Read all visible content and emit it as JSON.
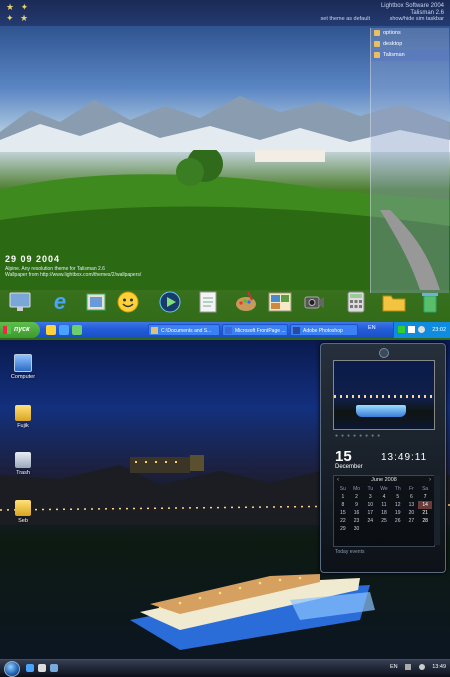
{
  "top_screen": {
    "brand_lines": [
      "Lightbox Software 2004",
      "Talisman 2.6"
    ],
    "brand_links": [
      "set theme as default",
      "show/hide sim taskbar"
    ],
    "side_panel": {
      "items": [
        {
          "label": "options",
          "active": false
        },
        {
          "label": "desktop",
          "active": false
        },
        {
          "label": "Talisman",
          "active": true
        }
      ]
    },
    "date": "29  09  2004",
    "caption_lines": [
      "Alpine. Any resolution theme for Talisman 2.6",
      "Wallpaper from http://www.lightbox.com/themes/2/wallpapers/"
    ],
    "dock_icons": [
      "monitor-icon",
      "internet-explorer-icon",
      "mail-stamp-icon",
      "smiley-messenger-icon",
      "media-player-icon",
      "notepad-icon",
      "paint-palette-icon",
      "photo-album-icon",
      "video-camera-icon",
      "calculator-icon",
      "folder-icon",
      "recycle-bin-icon"
    ],
    "taskbar": {
      "start_label": "пуск",
      "tasks": [
        "C:\\Documents and S...",
        "Microsoft FrontPage ...",
        "Adobe Photoshop"
      ],
      "language": "EN",
      "clock": "23:02"
    }
  },
  "bottom_screen": {
    "desktop_icons": [
      "Computer",
      "Fujik",
      "Trash",
      "Seb"
    ],
    "gadget": {
      "day": "15",
      "month": "December",
      "time": "13:49:11",
      "calendar_title": "June 2008",
      "weekdays": [
        "Su",
        "Mo",
        "Tu",
        "We",
        "Th",
        "Fr",
        "Sa"
      ],
      "days": [
        "1",
        "2",
        "3",
        "4",
        "5",
        "6",
        "7",
        "8",
        "9",
        "10",
        "11",
        "12",
        "13",
        "14",
        "15",
        "16",
        "17",
        "18",
        "19",
        "20",
        "21",
        "22",
        "23",
        "24",
        "25",
        "26",
        "27",
        "28",
        "29",
        "30"
      ],
      "today": "14",
      "status": "Today events"
    },
    "taskbar": {
      "language": "EN",
      "clock": "13:49"
    }
  },
  "colors": {
    "xp_taskbar": "#245edb",
    "xp_start": "#3b9a2c",
    "vista_orb": "#1f5fb0"
  }
}
